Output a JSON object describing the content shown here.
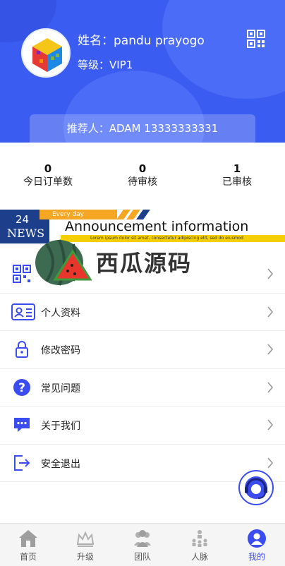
{
  "profile": {
    "name_text": "姓名：pandu prayogo",
    "level_text": "等级：VIP1",
    "referrer_text": "推荐人：ADAM  13333333331"
  },
  "stats": [
    {
      "value": "0",
      "label": "今日订单数"
    },
    {
      "value": "0",
      "label": "待审核"
    },
    {
      "value": "1",
      "label": "已审核"
    }
  ],
  "notice": {
    "day": "24",
    "news": "NEWS",
    "everyday": "Every day",
    "title": "Announcement information",
    "subtitle": "Lorem ipsum dolor sit amet, consectetur adipiscing elit, sed do eiusmod"
  },
  "watermark": {
    "text": "西瓜源码"
  },
  "menu": [
    {
      "label": "",
      "icon": "qr-code-icon"
    },
    {
      "label": "个人资料",
      "icon": "id-card-icon"
    },
    {
      "label": "修改密码",
      "icon": "lock-icon"
    },
    {
      "label": "常见问题",
      "icon": "question-icon"
    },
    {
      "label": "关于我们",
      "icon": "chat-icon"
    },
    {
      "label": "安全退出",
      "icon": "logout-icon"
    }
  ],
  "tabs": [
    {
      "label": "首页",
      "icon": "home-icon"
    },
    {
      "label": "升级",
      "icon": "crown-icon"
    },
    {
      "label": "团队",
      "icon": "team-icon"
    },
    {
      "label": "人脉",
      "icon": "network-icon"
    },
    {
      "label": "我的",
      "icon": "user-icon",
      "active": true
    }
  ],
  "colors": {
    "primary": "#3b5cf0",
    "accent": "#3b4df0",
    "tab_active": "#3b4df0"
  }
}
